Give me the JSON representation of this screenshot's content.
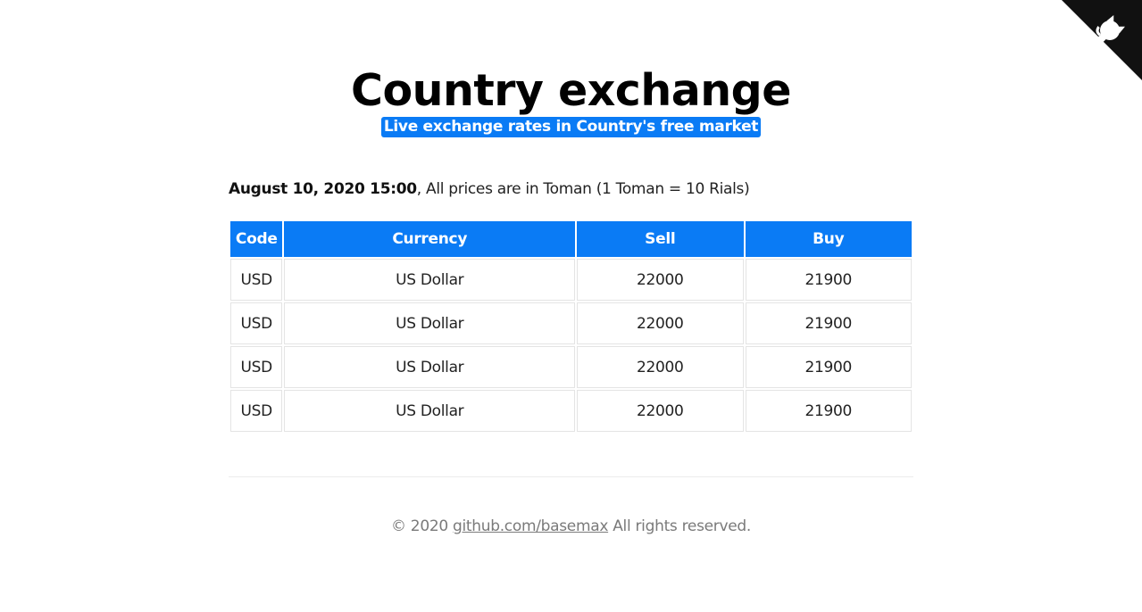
{
  "header": {
    "title": "Country exchange",
    "subtitle": "Live exchange rates in Country's free market"
  },
  "info": {
    "datetime": "August 10, 2020 15:00",
    "note": ", All prices are in Toman (1 Toman = 10 Rials)"
  },
  "table": {
    "columns": [
      "Code",
      "Currency",
      "Sell",
      "Buy"
    ],
    "rows": [
      {
        "code": "USD",
        "currency": "US Dollar",
        "sell": "22000",
        "buy": "21900"
      },
      {
        "code": "USD",
        "currency": "US Dollar",
        "sell": "22000",
        "buy": "21900"
      },
      {
        "code": "USD",
        "currency": "US Dollar",
        "sell": "22000",
        "buy": "21900"
      },
      {
        "code": "USD",
        "currency": "US Dollar",
        "sell": "22000",
        "buy": "21900"
      }
    ]
  },
  "footer": {
    "prefix": "© 2020 ",
    "link_text": "github.com/basemax",
    "suffix": " All rights reserved."
  },
  "icons": {
    "corner": "github-octocat-icon"
  },
  "colors": {
    "accent": "#0a7bf5",
    "corner": "#111111"
  }
}
